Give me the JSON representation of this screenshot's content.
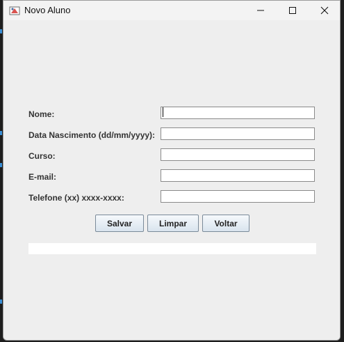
{
  "window": {
    "title": "Novo Aluno",
    "controls": {
      "minimize_icon": "minimize-icon",
      "maximize_icon": "maximize-icon",
      "close_icon": "close-icon"
    }
  },
  "form": {
    "fields": [
      {
        "label": "Nome:",
        "value": "",
        "focused": true
      },
      {
        "label": "Data Nascimento (dd/mm/yyyy):",
        "value": ""
      },
      {
        "label": "Curso:",
        "value": ""
      },
      {
        "label": "E-mail:",
        "value": ""
      },
      {
        "label": "Telefone (xx) xxxx-xxxx:",
        "value": ""
      }
    ]
  },
  "buttons": {
    "salvar": "Salvar",
    "limpar": "Limpar",
    "voltar": "Voltar"
  },
  "status": {
    "message": ""
  },
  "colors": {
    "window_bg": "#eeeeee",
    "titlebar_bg": "#f3f3f3",
    "button_top": "#f6f9fc",
    "button_bottom": "#d9e4ee"
  }
}
